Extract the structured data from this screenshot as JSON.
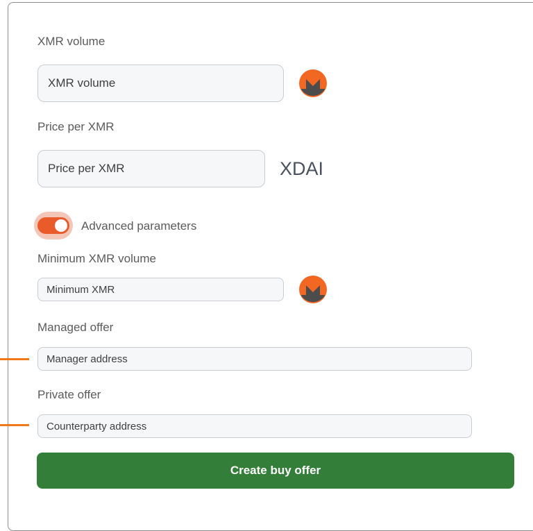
{
  "form": {
    "xmr_volume": {
      "label": "XMR volume",
      "placeholder": "XMR volume",
      "value": ""
    },
    "price_per_xmr": {
      "label": "Price per XMR",
      "placeholder": "Price per XMR",
      "value": "",
      "unit": "XDAI"
    },
    "advanced": {
      "label": "Advanced parameters",
      "enabled": true
    },
    "minimum_xmr": {
      "label": "Minimum XMR volume",
      "placeholder": "Minimum XMR",
      "value": ""
    },
    "managed_offer": {
      "label": "Managed offer",
      "placeholder": "Manager address",
      "value": ""
    },
    "private_offer": {
      "label": "Private offer",
      "placeholder": "Counterparty address",
      "value": ""
    },
    "submit_label": "Create buy offer"
  },
  "icons": {
    "currency": "monero-icon"
  },
  "colors": {
    "accent": "#ea5b2b",
    "toggle_halo": "#f4c6b8",
    "primary_button": "#337f3a",
    "monero_orange": "#f26822",
    "monero_dark": "#4c4c4c",
    "pointer_line": "#f07a1a"
  }
}
